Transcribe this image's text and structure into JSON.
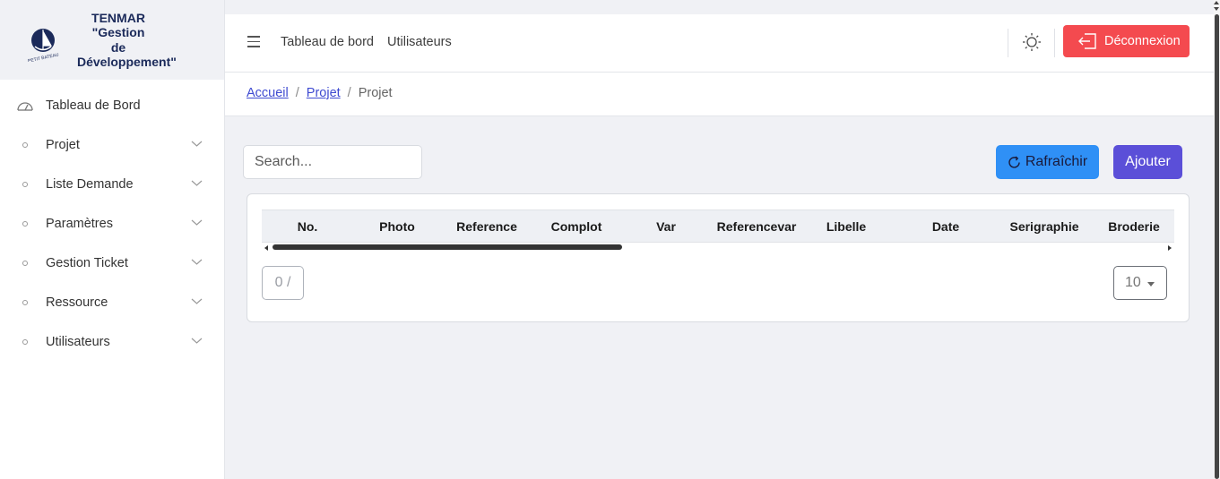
{
  "brand": {
    "line1": "TENMAR",
    "line2": "\"Gestion",
    "line3": "de",
    "line4": "Développement\""
  },
  "sidebar": {
    "items": [
      {
        "label": "Tableau de Bord",
        "icon": "dashboard-gauge-icon"
      },
      {
        "label": "Projet",
        "icon": "dot-icon"
      },
      {
        "label": "Liste Demande",
        "icon": "dot-icon"
      },
      {
        "label": "Paramètres",
        "icon": "dot-icon"
      },
      {
        "label": "Gestion Ticket",
        "icon": "dot-icon"
      },
      {
        "label": "Ressource",
        "icon": "dot-icon"
      },
      {
        "label": "Utilisateurs",
        "icon": "dot-icon"
      }
    ]
  },
  "header": {
    "links": [
      "Tableau de bord",
      "Utilisateurs"
    ],
    "logout_label": "Déconnexion",
    "accent_logout": "#f44a4f"
  },
  "breadcrumb": {
    "home": "Accueil",
    "section": "Projet",
    "current": "Projet",
    "separator": "/"
  },
  "toolbar": {
    "search_placeholder": "Search...",
    "refresh_label": "Rafraîchir",
    "add_label": "Ajouter"
  },
  "table": {
    "columns": [
      "No.",
      "Photo",
      "Reference",
      "Complot",
      "Var",
      "Referencevar",
      "Libelle",
      "Date",
      "Serigraphie",
      "Broderie"
    ],
    "rows": []
  },
  "pagination": {
    "page_indicator": "0 /",
    "page_size": "10"
  }
}
